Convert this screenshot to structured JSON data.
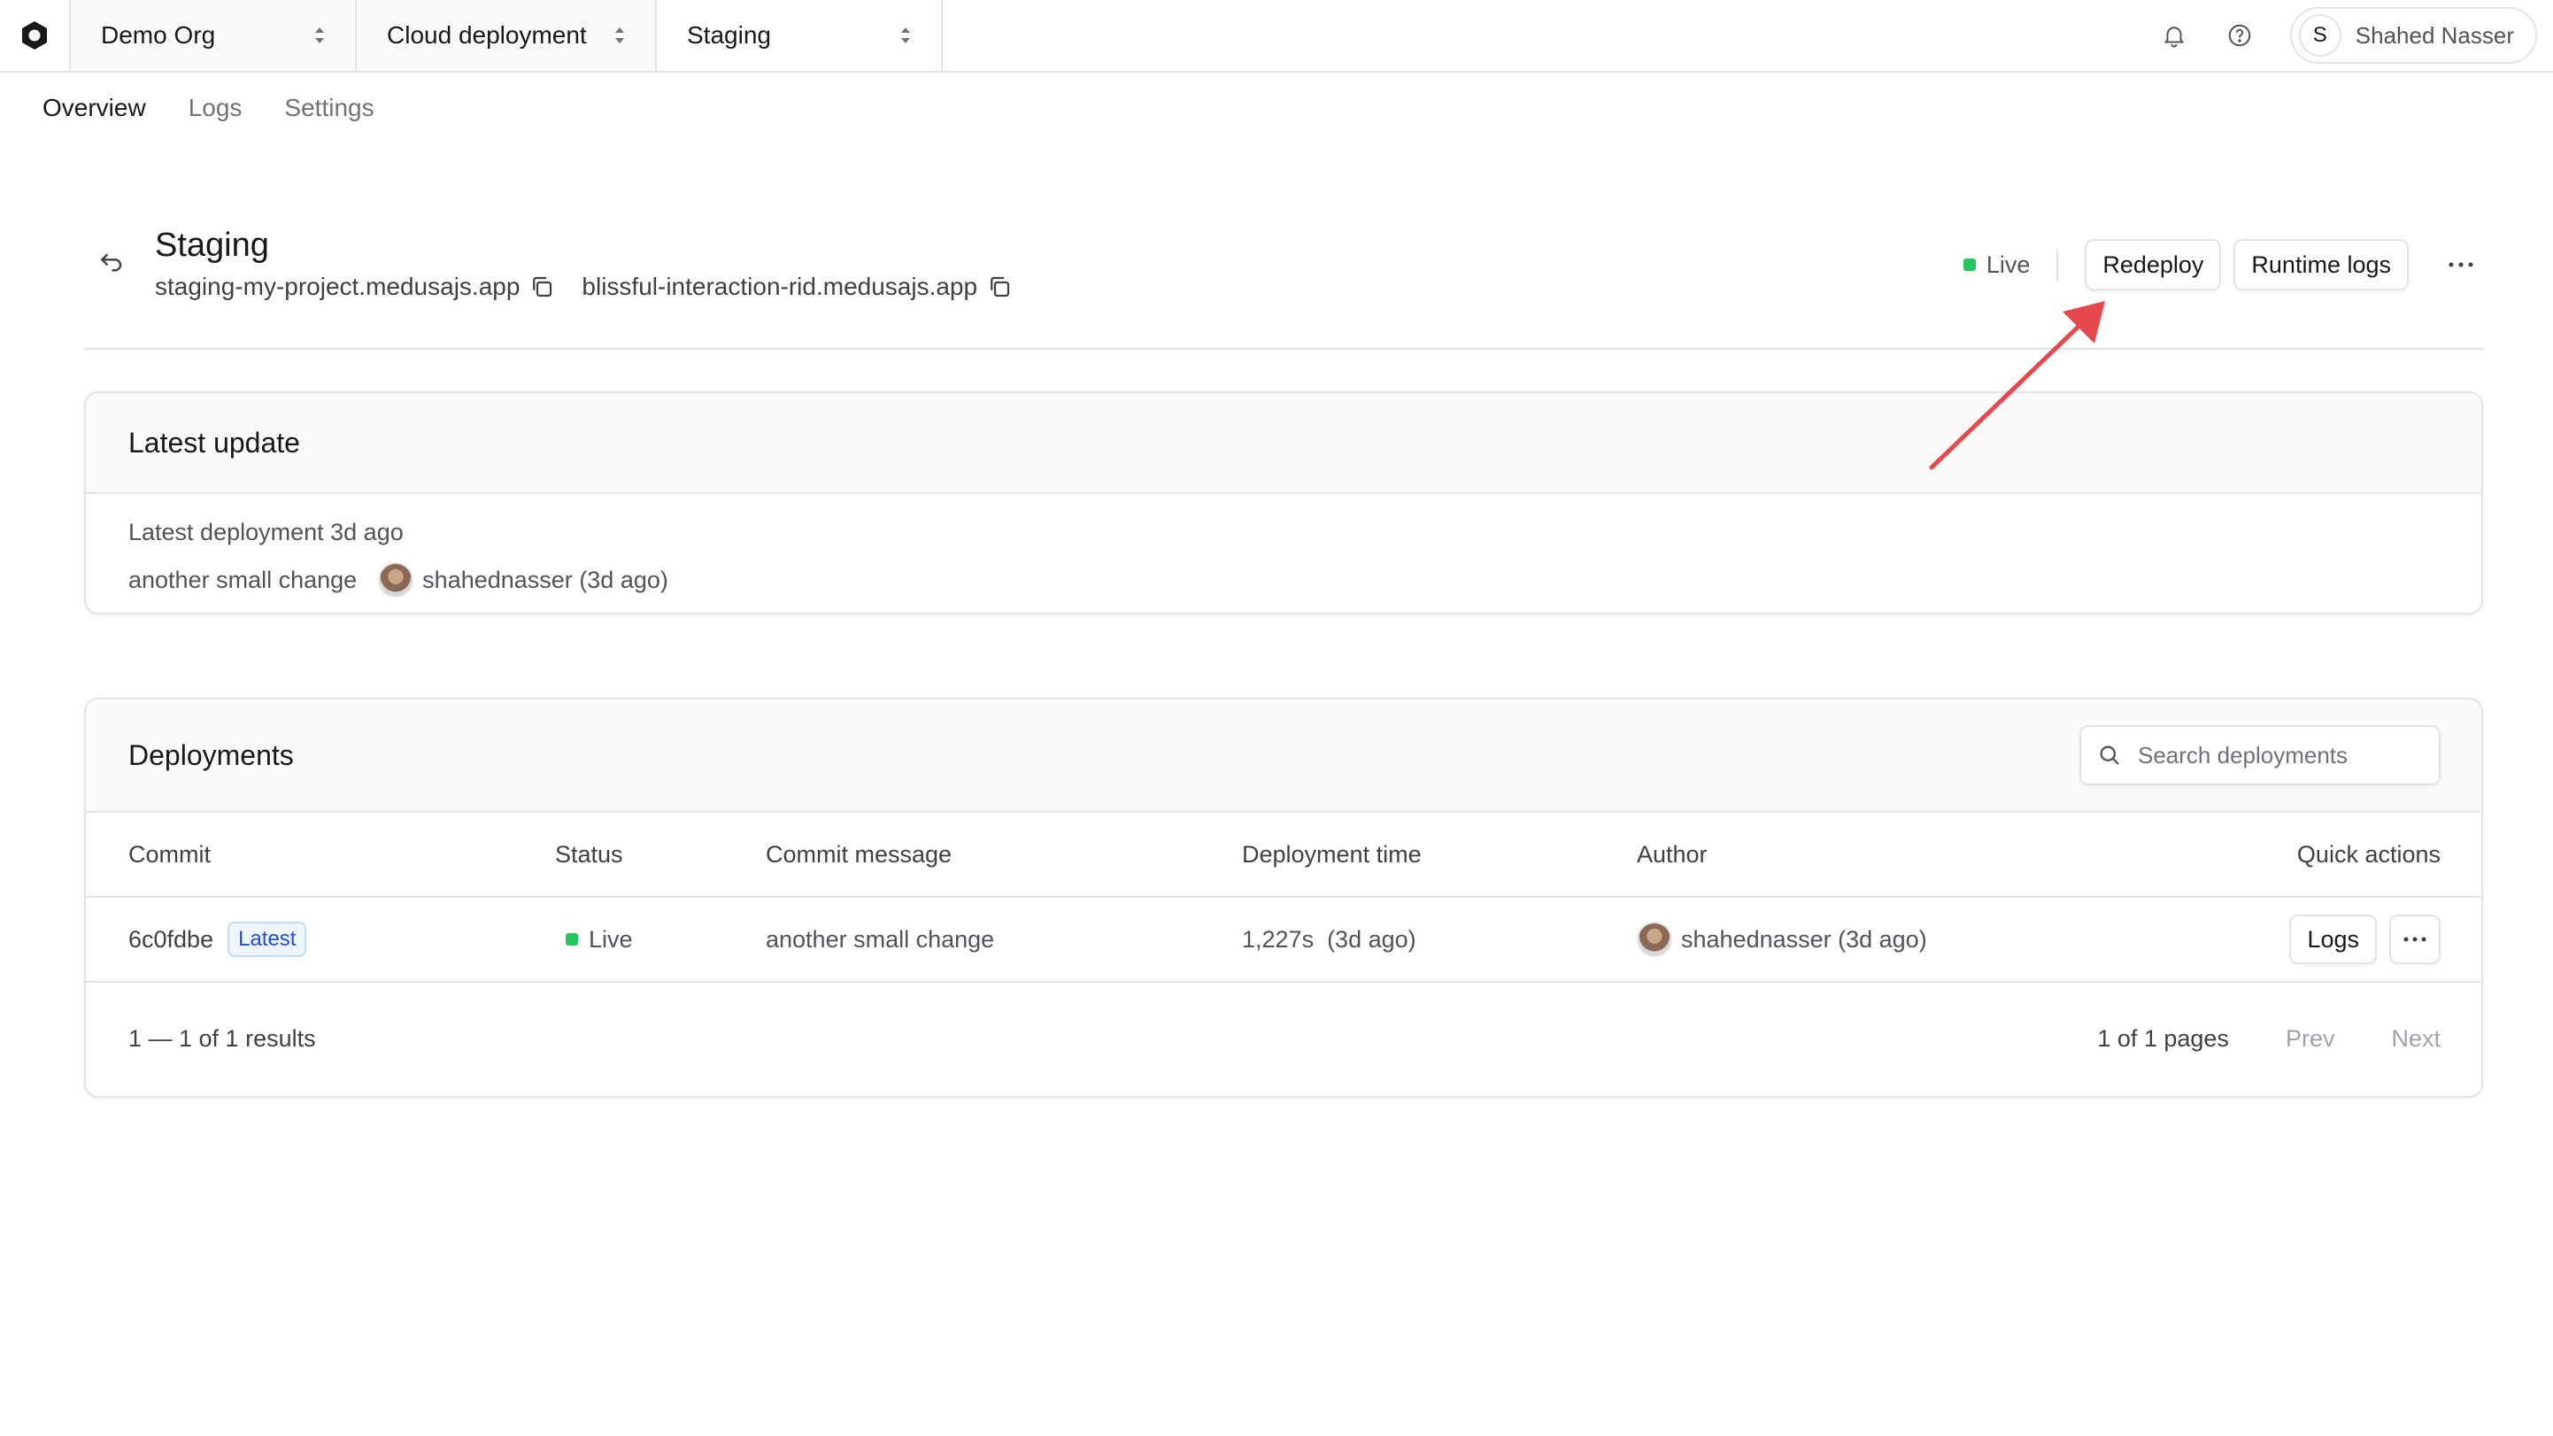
{
  "topbar": {
    "org": "Demo Org",
    "project": "Cloud deployment",
    "environment": "Staging",
    "user_initial": "S",
    "user_name": "Shahed Nasser"
  },
  "subnav": {
    "tabs": [
      "Overview",
      "Logs",
      "Settings"
    ],
    "active": "Overview"
  },
  "header": {
    "title": "Staging",
    "urls": [
      "staging-my-project.medusajs.app",
      "blissful-interaction-rid.medusajs.app"
    ],
    "status": "Live",
    "redeploy_label": "Redeploy",
    "runtime_logs_label": "Runtime logs"
  },
  "latest_update": {
    "title": "Latest update",
    "deployment_line": "Latest deployment 3d ago",
    "commit_message": "another small change",
    "author": "shahednasser (3d ago)"
  },
  "deployments": {
    "title": "Deployments",
    "search_placeholder": "Search deployments",
    "columns": [
      "Commit",
      "Status",
      "Commit message",
      "Deployment time",
      "Author",
      "Quick actions"
    ],
    "rows": [
      {
        "commit": "6c0fdbe",
        "badge": "Latest",
        "status": "Live",
        "message": "another small change",
        "time": "1,227s  (3d ago)",
        "author": "shahednasser (3d ago)",
        "action": "Logs"
      }
    ],
    "results": "1 — 1 of 1 results",
    "pages": "1 of 1 pages",
    "prev": "Prev",
    "next": "Next"
  },
  "colors": {
    "live": "#22c55e",
    "annotation_arrow": "#e5484d",
    "badge_text": "#1d4ed8"
  }
}
